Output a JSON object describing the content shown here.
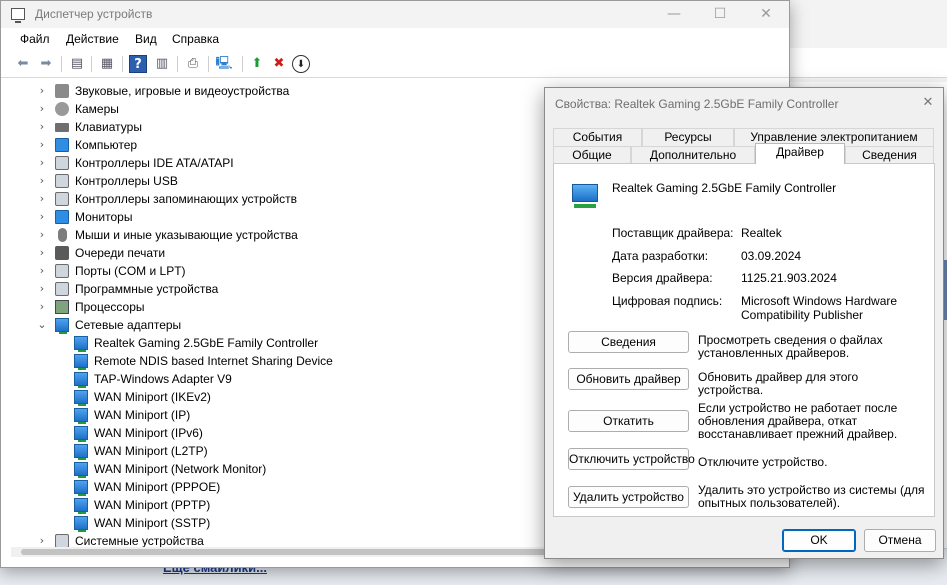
{
  "background": {
    "link_text": "Еще смайлики..."
  },
  "device_manager": {
    "title": "Диспетчер устройств",
    "window_buttons": {
      "minimize": "—",
      "maximize": "☐",
      "close": "✕"
    },
    "menu": [
      "Файл",
      "Действие",
      "Вид",
      "Справка"
    ],
    "toolbar_icons": [
      "back-arrow-icon",
      "forward-arrow-icon",
      "show-hide-console-tree-icon",
      "properties-icon",
      "help-icon",
      "action-pane-icon",
      "print-icon",
      "scan-hardware-icon",
      "update-driver-icon",
      "uninstall-device-icon",
      "disable-device-icon"
    ],
    "tree": [
      {
        "label": "Звуковые, игровые и видеоустройства",
        "expand": "›",
        "icon": "speaker"
      },
      {
        "label": "Камеры",
        "expand": "›",
        "icon": "camera"
      },
      {
        "label": "Клавиатуры",
        "expand": "›",
        "icon": "keyboard"
      },
      {
        "label": "Компьютер",
        "expand": "›",
        "icon": "monitor"
      },
      {
        "label": "Контроллеры IDE ATA/ATAPI",
        "expand": "›",
        "icon": "controller"
      },
      {
        "label": "Контроллеры USB",
        "expand": "›",
        "icon": "usb"
      },
      {
        "label": "Контроллеры запоминающих устройств",
        "expand": "›",
        "icon": "storage"
      },
      {
        "label": "Мониторы",
        "expand": "›",
        "icon": "monitor"
      },
      {
        "label": "Мыши и иные указывающие устройства",
        "expand": "›",
        "icon": "mouse"
      },
      {
        "label": "Очереди печати",
        "expand": "›",
        "icon": "printer"
      },
      {
        "label": "Порты (COM и LPT)",
        "expand": "›",
        "icon": "port"
      },
      {
        "label": "Программные устройства",
        "expand": "›",
        "icon": "software"
      },
      {
        "label": "Процессоры",
        "expand": "›",
        "icon": "cpu"
      },
      {
        "label": "Сетевые адаптеры",
        "expand": "⌄",
        "icon": "network"
      },
      {
        "label": "Realtek Gaming 2.5GbE Family Controller",
        "child": true,
        "icon": "network"
      },
      {
        "label": "Remote NDIS based Internet Sharing Device",
        "child": true,
        "icon": "network"
      },
      {
        "label": "TAP-Windows Adapter V9",
        "child": true,
        "icon": "network"
      },
      {
        "label": "WAN Miniport (IKEv2)",
        "child": true,
        "icon": "network"
      },
      {
        "label": "WAN Miniport (IP)",
        "child": true,
        "icon": "network"
      },
      {
        "label": "WAN Miniport (IPv6)",
        "child": true,
        "icon": "network"
      },
      {
        "label": "WAN Miniport (L2TP)",
        "child": true,
        "icon": "network"
      },
      {
        "label": "WAN Miniport (Network Monitor)",
        "child": true,
        "icon": "network"
      },
      {
        "label": "WAN Miniport (PPPOE)",
        "child": true,
        "icon": "network"
      },
      {
        "label": "WAN Miniport (PPTP)",
        "child": true,
        "icon": "network"
      },
      {
        "label": "WAN Miniport (SSTP)",
        "child": true,
        "icon": "network"
      },
      {
        "label": "Системные устройства",
        "expand": "›",
        "icon": "system"
      }
    ]
  },
  "dialog": {
    "title": "Свойства: Realtek Gaming 2.5GbE Family Controller",
    "close": "✕",
    "tabs_top": [
      "События",
      "Ресурсы",
      "Управление электропитанием"
    ],
    "tabs_bottom": [
      "Общие",
      "Дополнительно",
      "Драйвер",
      "Сведения"
    ],
    "active_tab": "Драйвер",
    "device_name": "Realtek Gaming 2.5GbE Family Controller",
    "properties": [
      {
        "label": "Поставщик драйвера:",
        "value": "Realtek"
      },
      {
        "label": "Дата разработки:",
        "value": "03.09.2024"
      },
      {
        "label": "Версия драйвера:",
        "value": "1125.21.903.2024"
      },
      {
        "label": "Цифровая подпись:",
        "value": "Microsoft Windows Hardware Compatibility Publisher"
      }
    ],
    "actions": [
      {
        "button": "Сведения",
        "description": "Просмотреть сведения о файлах установленных драйверов."
      },
      {
        "button": "Обновить драйвер",
        "description": "Обновить драйвер для этого устройства."
      },
      {
        "button": "Откатить",
        "description": "Если устройство не работает после обновления драйвера, откат восстанавливает прежний драйвер."
      },
      {
        "button": "Отключить устройство",
        "description": "Отключите устройство."
      },
      {
        "button": "Удалить устройство",
        "description": "Удалить это устройство из системы (для опытных пользователей)."
      }
    ],
    "ok": "OK",
    "cancel": "Отмена"
  }
}
